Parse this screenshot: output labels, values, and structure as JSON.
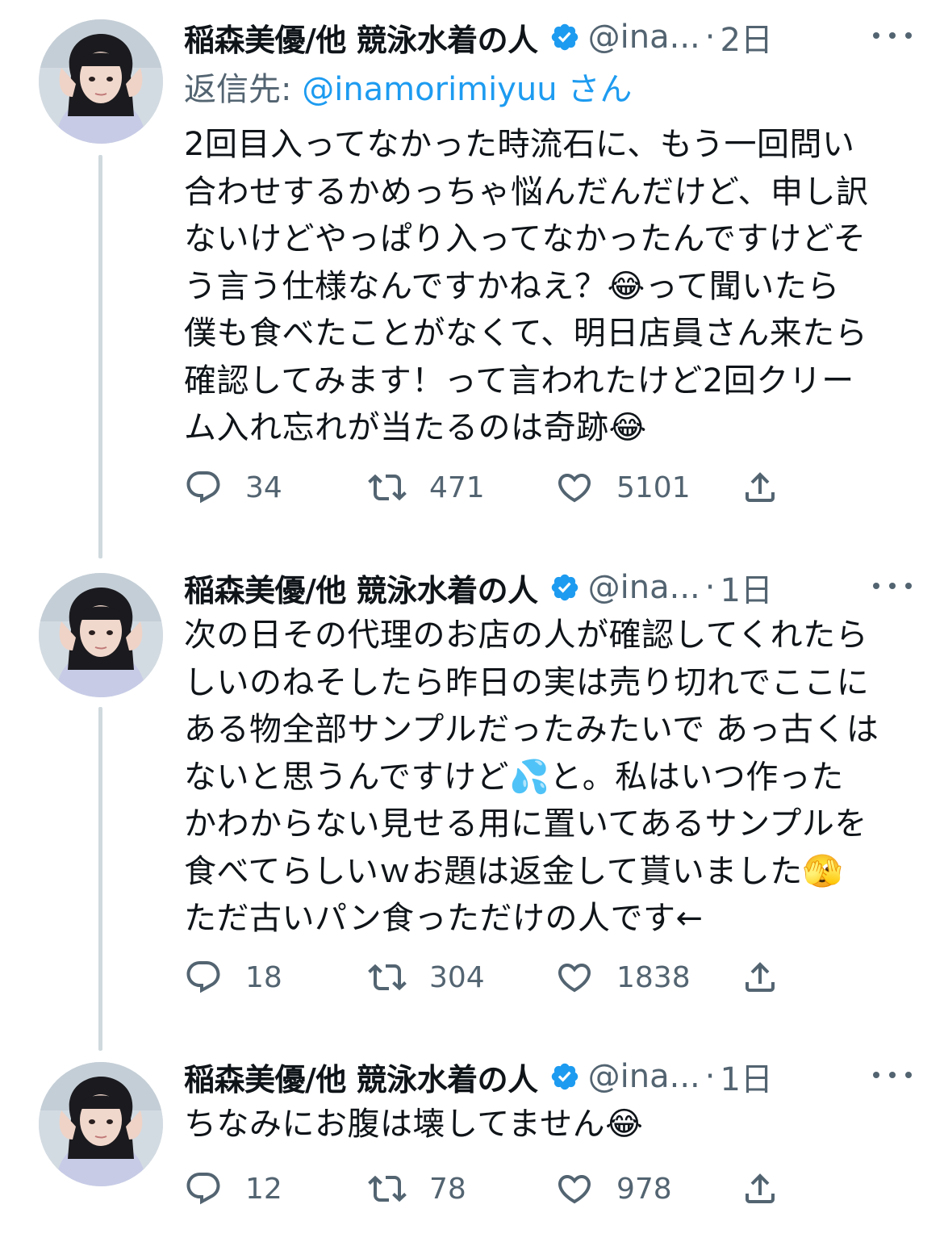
{
  "tweets": [
    {
      "author_name": "稲森美優/他 競泳水着の人",
      "handle": "@ina...",
      "separator": "·",
      "time": "2日",
      "reply_to_prefix": "返信先: ",
      "reply_to_handle": "@inamorimiyuu",
      "reply_to_suffix": " さん",
      "text": "2回目入ってなかった時流石に、もう一回問い\n合わせするかめっちゃ悩んだんだけど、申し訳\nないけどやっぱり入ってなかったんですけどそ\nう言う仕様なんですかねえ？😂って聞いたら\n僕も食べたことがなくて、明日店員さん来たら\n確認してみます！って言われたけど2回クリー\nム入れ忘れが当たるのは奇跡😂",
      "replies": "34",
      "retweets": "471",
      "likes": "5101"
    },
    {
      "author_name": "稲森美優/他 競泳水着の人",
      "handle": "@ina...",
      "separator": "·",
      "time": "1日",
      "text": "次の日その代理のお店の人が確認してくれたら\nしいのねそしたら昨日の実は売り切れでここに\nある物全部サンプルだったみたいで あっ古くは\nないと思うんですけど💦と。私はいつ作った\nかわからない見せる用に置いてあるサンプルを\n食べてらしいｗお題は返金して貰いました🫣\nただ古いパン食っただけの人です←",
      "replies": "18",
      "retweets": "304",
      "likes": "1838"
    },
    {
      "author_name": "稲森美優/他 競泳水着の人",
      "handle": "@ina...",
      "separator": "·",
      "time": "1日",
      "text": "ちなみにお腹は壊してません😂",
      "replies": "12",
      "retweets": "78",
      "likes": "978"
    }
  ],
  "colors": {
    "text": "#0f1419",
    "secondary": "#536471",
    "accent": "#1d9bf0",
    "thread_line": "#cfd9de"
  },
  "icons": [
    "verified-badge-icon",
    "more-icon",
    "reply-icon",
    "retweet-icon",
    "like-icon",
    "share-icon"
  ]
}
